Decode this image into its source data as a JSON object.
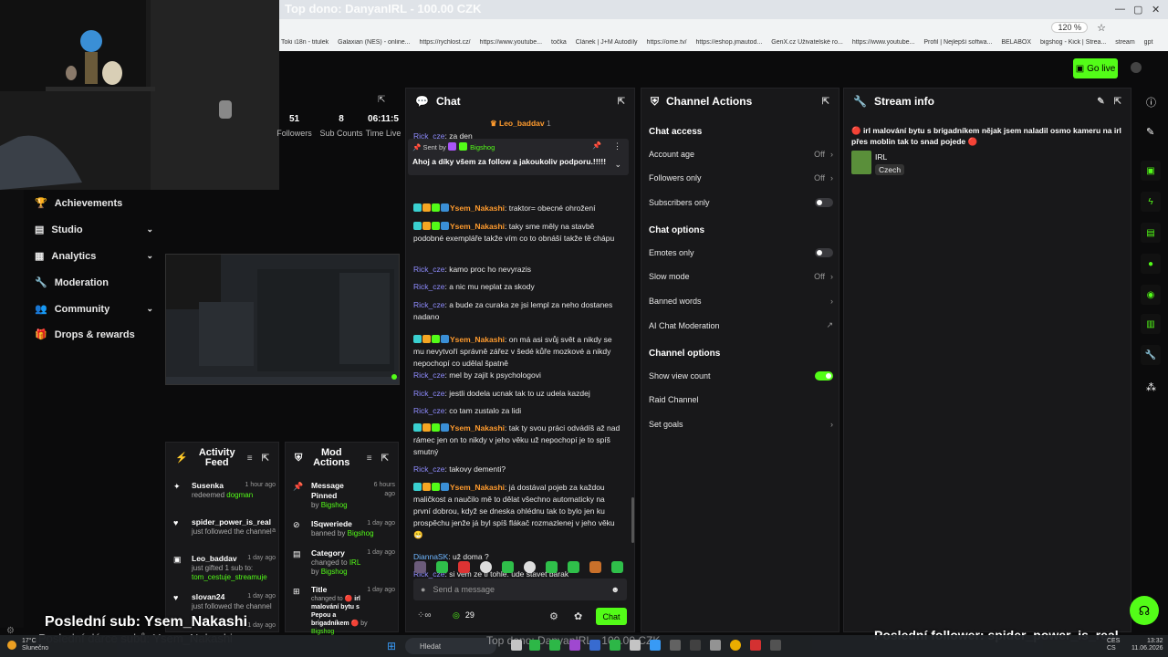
{
  "browser": {
    "tab_title": "Top dono: DanyanIRL - 100.00 CZK",
    "zoom": "120 %",
    "bookmarks": [
      "Toki i18n - titulek",
      "Galaxian (NES) - online...",
      "https://rychlost.cz/",
      "https://www.youtube...",
      "točka",
      "Článek | J+M Autodíly",
      "https://ome.tv/",
      "https://eshop.jmautod...",
      "GenX.cz Uživatelské ro...",
      "https://www.youtube...",
      "Profil | Nejlepší softwa...",
      "BELABOX",
      "bigshog - Kick | Strea...",
      "stream",
      "gpt"
    ]
  },
  "topbar": {
    "go_live": "Go live"
  },
  "nav": {
    "items": [
      {
        "label": "Achievements"
      },
      {
        "label": "Studio"
      },
      {
        "label": "Analytics"
      },
      {
        "label": "Moderation"
      },
      {
        "label": "Community"
      },
      {
        "label": "Drops & rewards"
      }
    ]
  },
  "stats": {
    "followers_val": "51",
    "followers_label": "Followers",
    "subs_val": "8",
    "subs_label": "Sub Counts",
    "time_val": "06:11:5",
    "time_label": "Time Live"
  },
  "chat": {
    "title": "Chat",
    "top_user": "Leo_baddav",
    "top_user_count": "1",
    "partial_user": "Rick_cze",
    "partial_text": ": za den",
    "pinned_sent_by": "Sent by",
    "pinned_user": "Bigshog",
    "pinned_text": "Ahoj a díky všem za follow a jakoukoliv podporu.!!!!!",
    "messages": [
      {
        "user": "Ysem_Nakashi",
        "text": ": traktor= obecné ohrožení"
      },
      {
        "user": "Ysem_Nakashi",
        "text": ": taky sme měly na stavbě podobné exempláře takže vím co to obnáší takže tě chápu"
      },
      {
        "user": "Rick_cze",
        "text": ": kamo proc ho nevyrazis"
      },
      {
        "user": "Rick_cze",
        "text": ": a nic mu neplat za skody"
      },
      {
        "user": "Rick_cze",
        "text": ": a bude za curaka ze jsi lempl za neho dostanes nadano"
      },
      {
        "user": "Ysem_Nakashi",
        "text": ": on má asi svůj svět a nikdy se mu nevytvoří správně zářez v šedé kůře mozkové a nikdy nepochopí co udělal špatně"
      },
      {
        "user": "Rick_cze",
        "text": ": mel by zajit k psychologovi"
      },
      {
        "user": "Rick_cze",
        "text": ": jestli dodela ucnak tak to uz udela kazdej"
      },
      {
        "user": "Rick_cze",
        "text": ": co tam zustalo za lidi"
      },
      {
        "user": "Ysem_Nakashi",
        "text": ": tak ty svou práci odvádíš až nad rámec jen on to nikdy v jeho věku už nepochopí je to spíš smutný"
      },
      {
        "user": "Rick_cze",
        "text": ": takovy dementi?"
      },
      {
        "user": "Ysem_Nakashi",
        "text": ": já dostával pojeb za každou maličkost a naučilo mě to dělat všechno automaticky na první dobrou, když se dneska ohlédnu tak to bylo jen ku prospěchu jenže já byl spíš flákač rozmazlenej v jeho věku 😁"
      },
      {
        "user": "DiannaSK",
        "text": ": už doma ?"
      },
      {
        "user": "Rick_cze",
        "text": ": si vem ze ti tohle. ude stavet barak"
      }
    ],
    "input_placeholder": "Send a message",
    "viewer_count": "29",
    "send_label": "Chat"
  },
  "channel_actions": {
    "title": "Channel Actions",
    "chat_access": "Chat access",
    "account_age": "Account age",
    "account_age_val": "Off",
    "followers_only": "Followers only",
    "followers_only_val": "Off",
    "subscribers_only": "Subscribers only",
    "chat_options": "Chat options",
    "emotes_only": "Emotes only",
    "slow_mode": "Slow mode",
    "slow_mode_val": "Off",
    "banned_words": "Banned words",
    "ai_moderation": "AI Chat Moderation",
    "channel_options": "Channel options",
    "show_view_count": "Show view count",
    "raid_channel": "Raid Channel",
    "set_goals": "Set goals",
    "toggles": {
      "subscribers_only": false,
      "emotes_only": false,
      "show_view_count": true
    }
  },
  "stream_info": {
    "title": "Stream info",
    "description": "🔴 irl malování bytu s brigadníkem nějak jsem naladil osmo kameru na irl přes moblin tak to snad pojede 🔴",
    "category": "IRL",
    "language": "Czech"
  },
  "activity": {
    "title": "Activity Feed",
    "items": [
      {
        "user": "Susenka",
        "time": "1 hour ago",
        "pre": "redeemed",
        "detail": "dogman"
      },
      {
        "user": "spider_power_is_real",
        "time": "a",
        "pre": "just followed the channel",
        "detail": ""
      },
      {
        "user": "Leo_baddav",
        "time": "1 day ago",
        "pre": "just gifted 1 sub to:",
        "detail": "tom_cestuje_streamuje"
      },
      {
        "user": "slovan24",
        "time": "1 day ago",
        "pre": "just followed the channel",
        "detail": ""
      },
      {
        "user": "",
        "time": "1 day ago",
        "pre": "",
        "detail": ""
      }
    ]
  },
  "mod_actions": {
    "title": "Mod Actions",
    "items": [
      {
        "action": "Message Pinned",
        "time": "6 hours ago",
        "pre": "by",
        "by": "Bigshog"
      },
      {
        "action": "lSqweriede",
        "time": "1 day ago",
        "pre": "banned by",
        "by": "Bigshog"
      },
      {
        "action": "Category",
        "time": "1 day ago",
        "pre": "changed to",
        "value": "IRL",
        "mid": "by",
        "by": "Bigshog"
      },
      {
        "action": "Title",
        "time": "1 day ago",
        "pre": "changed to 🔴",
        "value": "irl malování bytu s Pepou a brigadníkem",
        "mid": "🔴 by",
        "by": "Bigshog"
      }
    ]
  },
  "overlays": {
    "last_sub": "Poslední sub: Ysem_Nakashi",
    "last_donor": "Poslední dárce subů: Ysem_Nakashi",
    "last_follower": "Poslední follower: spider_power_is_real",
    "top_dono": "Top dono: DanyanIRL - 100.00 CZK"
  },
  "taskbar": {
    "temp": "17°C",
    "weather": "Slunečno",
    "search": "Hledat",
    "lang1": "CES",
    "lang2": "CS",
    "time": "13:32",
    "date": "11.06.2026"
  },
  "colors": {
    "accent": "#53fc18",
    "panel": "#18181a",
    "bg": "#0b0b0c"
  }
}
